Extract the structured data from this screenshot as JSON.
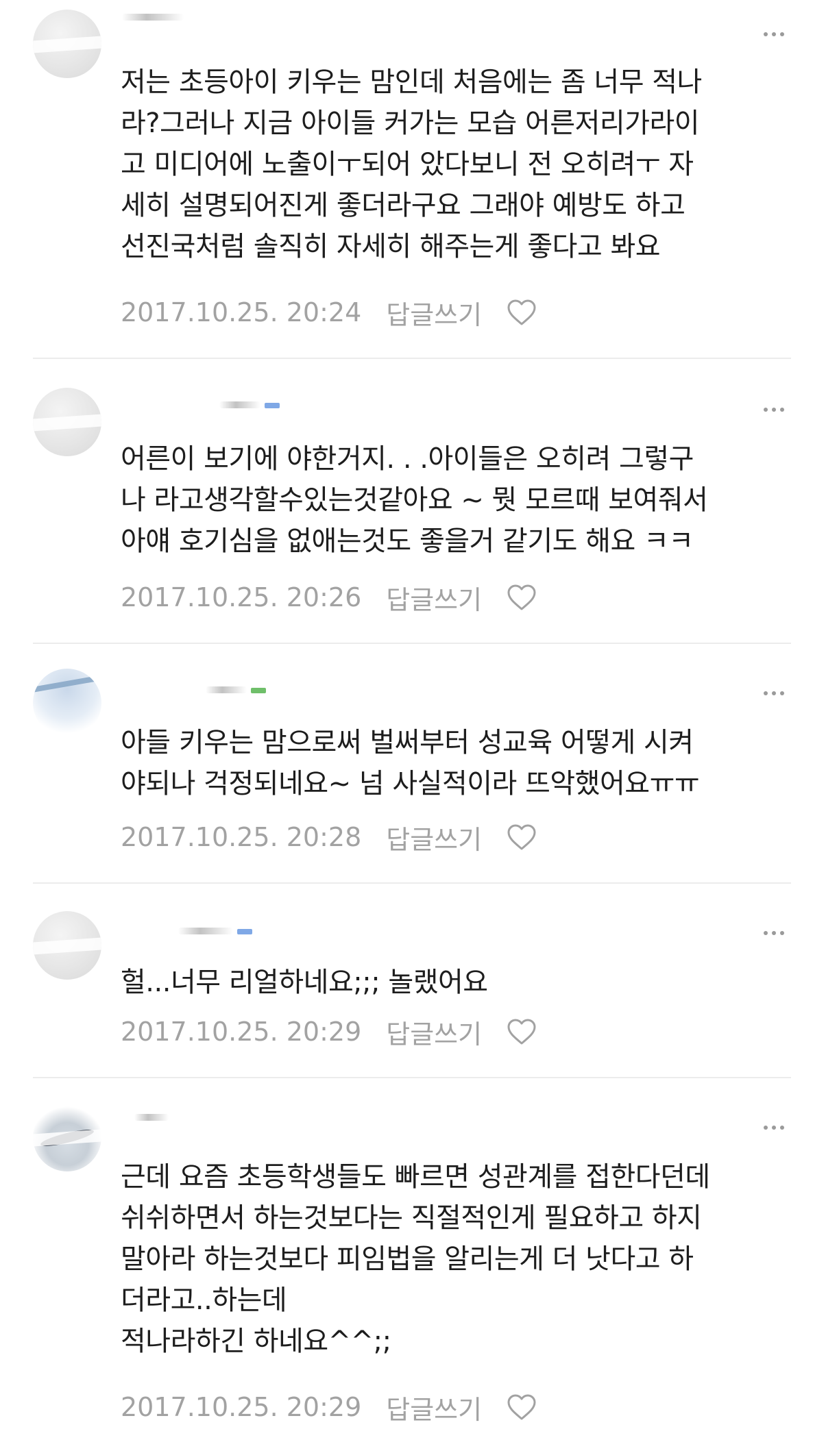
{
  "comments": [
    {
      "text": "저는 초등아이 키우는 맘인데 처음에는 좀 너무 적나\n라?그러나 지금 아이들 커가는 모습 어른저리가라이\n고 미디어에 노출이ㅜ되어 았다보니 전 오히려ㅜ 자\n세히 설명되어진게 좋더라구요 그래야 예방도 하고\n선진국처럼 솔직히 자세히 해주는게 좋다고 봐요",
      "time": "2017.10.25. 20:24",
      "reply_label": "답글쓰기"
    },
    {
      "text": "어른이 보기에 야한거지. . .아이들은 오히려 그렇구\n나 라고생각할수있는것같아요 ~ 뭣 모르때 보여줘서\n아얘 호기심을 없애는것도 좋을거 같기도 해요 ㅋㅋ",
      "time": "2017.10.25. 20:26",
      "reply_label": "답글쓰기"
    },
    {
      "text": "아들 키우는 맘으로써 벌써부터 성교육 어떻게 시켜\n야되나 걱정되네요~ 넘 사실적이라 뜨악했어요ㅠㅠ",
      "time": "2017.10.25. 20:28",
      "reply_label": "답글쓰기"
    },
    {
      "text": "헐...너무 리얼하네요;;; 놀랬어요",
      "time": "2017.10.25. 20:29",
      "reply_label": "답글쓰기"
    },
    {
      "text": "근데 요즘 초등학생들도 빠르면 성관계를 접한다던데\n쉬쉬하면서 하는것보다는 직절적인게 필요하고 하지\n말아라 하는것보다 피임법을 알리는게 더 낫다고 하\n더라고..하는데\n적나라하긴 하네요^^;;",
      "time": "2017.10.25. 20:29",
      "reply_label": "답글쓰기"
    }
  ],
  "icons": {
    "more": "more-dots-icon",
    "like": "heart-icon"
  },
  "colors": {
    "text": "#1d1d1d",
    "meta": "#a2a2a2",
    "divider": "#ececec"
  }
}
